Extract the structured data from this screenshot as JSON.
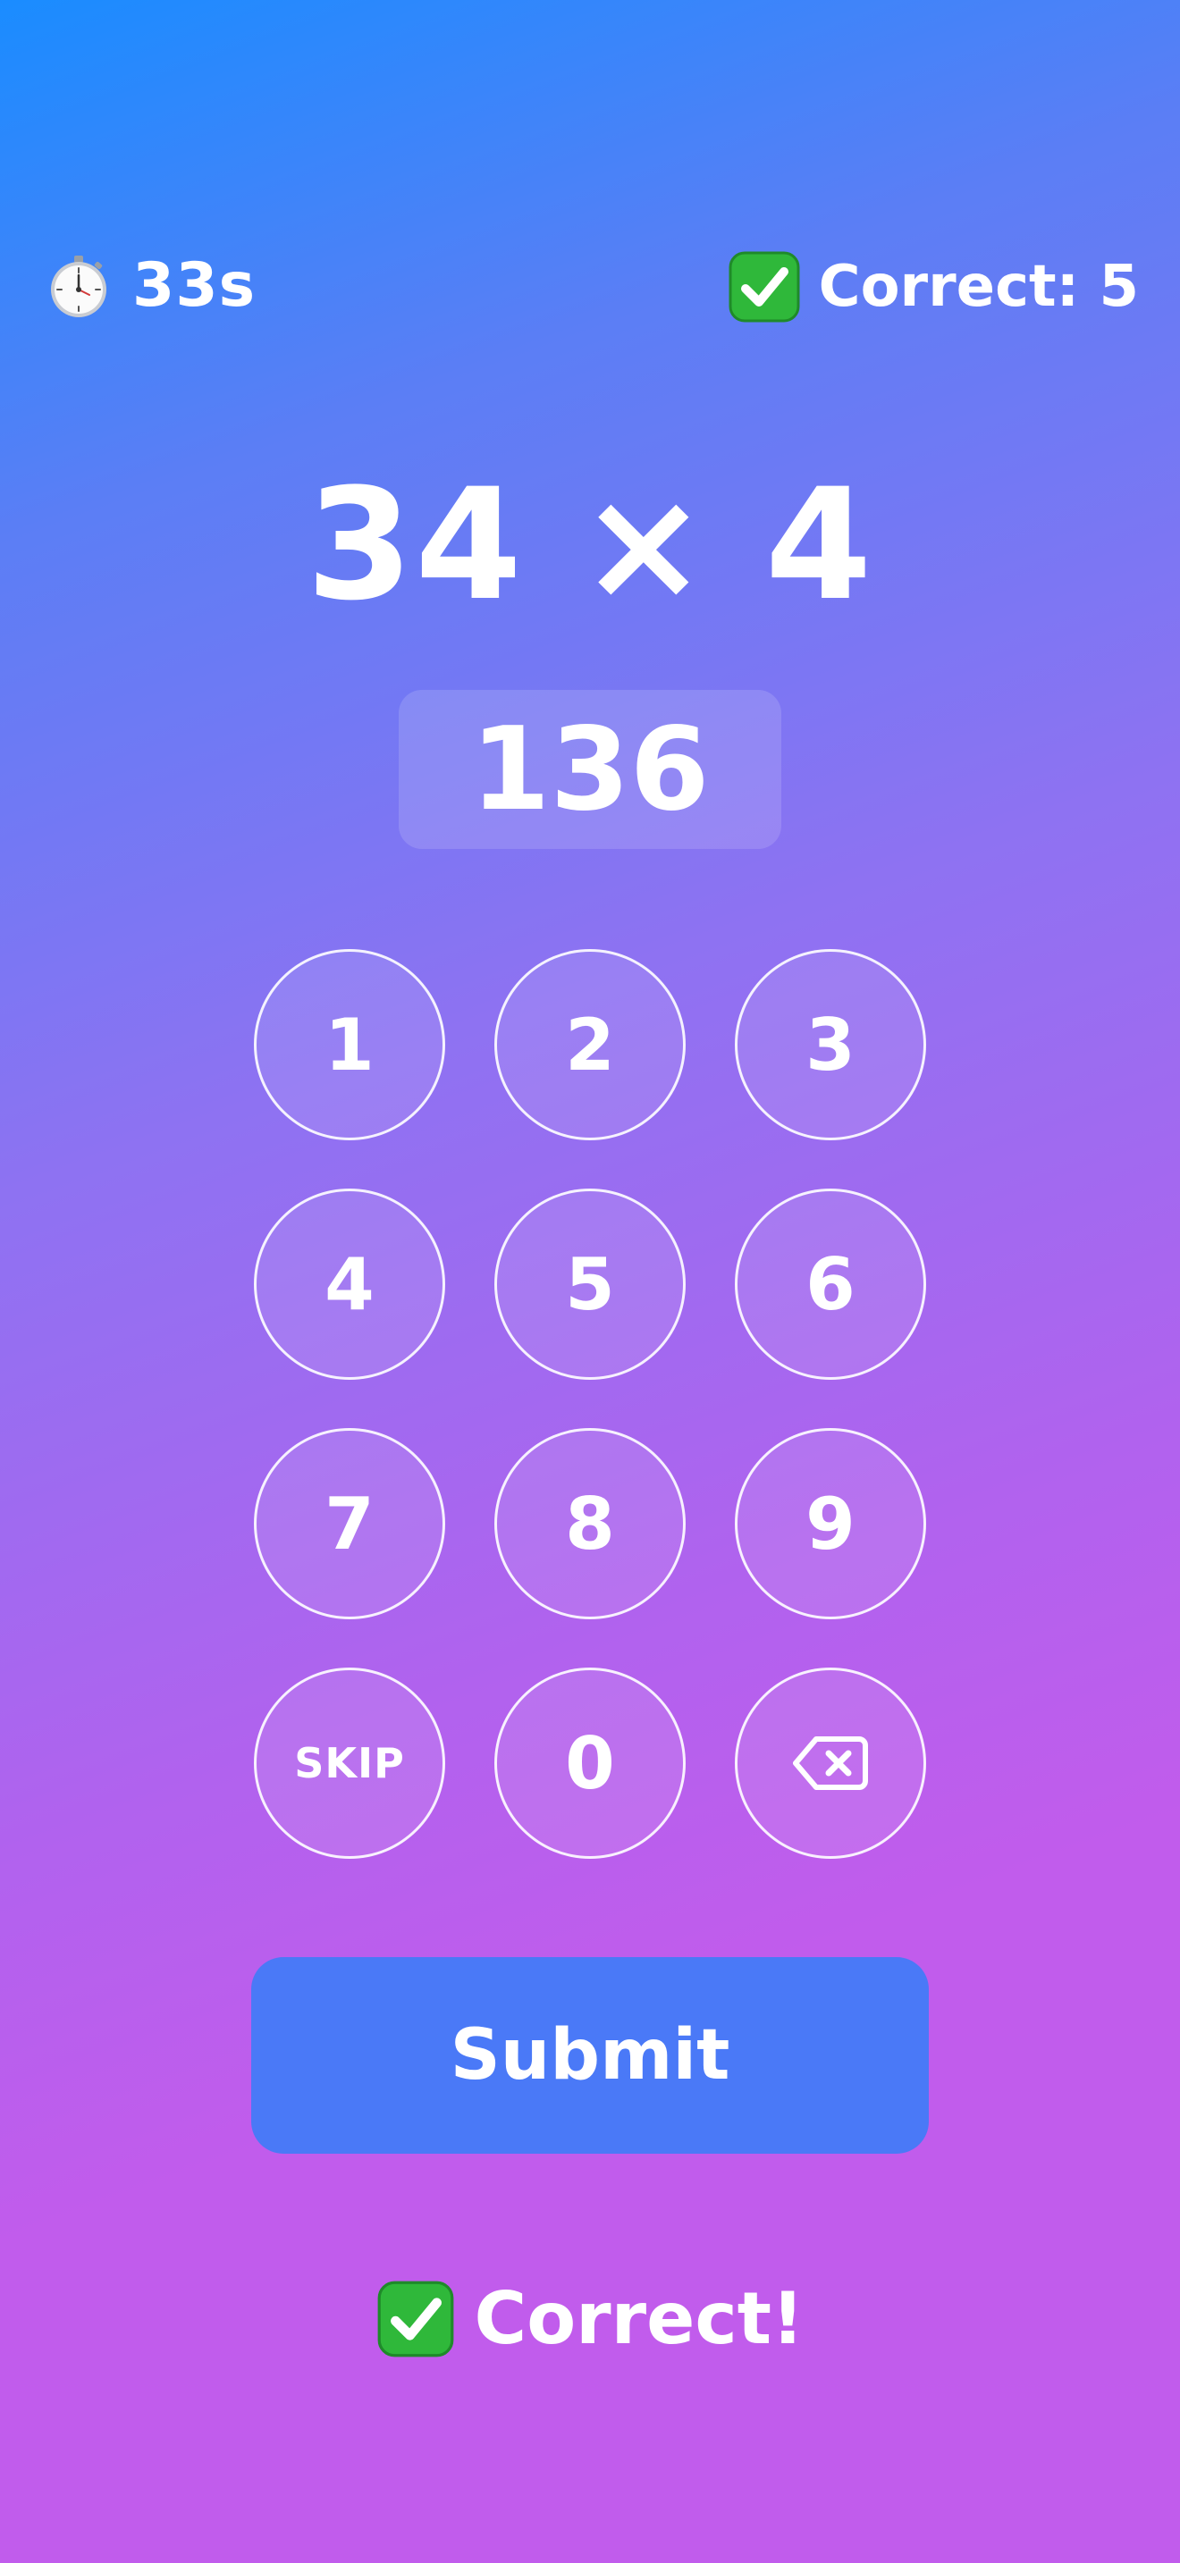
{
  "header": {
    "timer_icon": "stopwatch-icon",
    "timer_text": "33s",
    "score_icon": "check-mark-icon",
    "score_text": "Correct: 5"
  },
  "problem": {
    "text": "34 × 4"
  },
  "answer": {
    "value": "136"
  },
  "keypad": {
    "keys": [
      "1",
      "2",
      "3",
      "4",
      "5",
      "6",
      "7",
      "8",
      "9",
      "SKIP",
      "0"
    ],
    "backspace_icon": "backspace-icon"
  },
  "submit": {
    "label": "Submit",
    "color": "#4a79f7"
  },
  "feedback": {
    "icon": "check-mark-icon",
    "text": "Correct!",
    "icon_color": "#2fb83a"
  },
  "colors": {
    "gradient_top": "#1a8cff",
    "gradient_bottom": "#c15cec",
    "text": "#ffffff"
  }
}
